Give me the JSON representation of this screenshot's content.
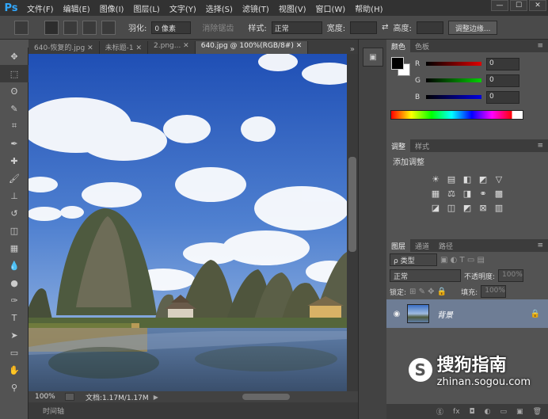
{
  "app": {
    "logo": "Ps"
  },
  "menu": [
    "文件(F)",
    "编辑(E)",
    "图像(I)",
    "图层(L)",
    "文字(Y)",
    "选择(S)",
    "滤镜(T)",
    "视图(V)",
    "窗口(W)",
    "帮助(H)"
  ],
  "window_controls": [
    "—",
    "☐",
    "✕"
  ],
  "options": {
    "feather_label": "羽化:",
    "feather_value": "0 像素",
    "antialias_label": "消除锯齿",
    "style_label": "样式:",
    "style_value": "正常",
    "width_label": "宽度:",
    "height_label": "高度:",
    "refine_edge": "调整边缘..."
  },
  "tabs": [
    {
      "label": "640-恢复的.jpg ✕"
    },
    {
      "label": "未标题-1 ✕"
    },
    {
      "label": "2.png... ✕"
    },
    {
      "label": "640.jpg @ 100%(RGB/8#) ✕",
      "active": true
    }
  ],
  "tab_overflow": "»",
  "status": {
    "zoom": "100%",
    "doc": "文档:1.17M/1.17M",
    "arrow": "▶"
  },
  "timeline": {
    "label": "时间轴"
  },
  "color_panel": {
    "tabs": [
      "颜色",
      "色板"
    ],
    "channels": [
      {
        "label": "R",
        "value": "0",
        "gradient": "#c00000"
      },
      {
        "label": "G",
        "value": "0",
        "gradient": "#00c000"
      },
      {
        "label": "B",
        "value": "0",
        "gradient": "#0000c0"
      }
    ]
  },
  "adjust_panel": {
    "tabs": [
      "调整",
      "样式"
    ],
    "title": "添加调整",
    "rows": [
      [
        "☀",
        "▤",
        "◧",
        "◩",
        "▽"
      ],
      [
        "▦",
        "⚖",
        "◨",
        "⚭",
        "▩"
      ],
      [
        "◪",
        "◫",
        "◩",
        "⊠",
        "▥"
      ]
    ]
  },
  "layers_panel": {
    "tabs": [
      "图层",
      "通道",
      "路径"
    ],
    "filter_label": "ρ 类型",
    "blend_mode": "正常",
    "opacity_label": "不透明度:",
    "opacity_value": "100%",
    "lock_label": "锁定:",
    "fill_label": "填充:",
    "fill_value": "100%",
    "layer_name": "背景",
    "footer_icons": [
      "ⓖ",
      "fx",
      "◘",
      "◐",
      "▭",
      "▣",
      "🗑"
    ]
  },
  "watermark": {
    "brand": "搜狗指南",
    "url": "zhinan.sogou.com",
    "logo": "S"
  },
  "accent": "#31a8ff"
}
